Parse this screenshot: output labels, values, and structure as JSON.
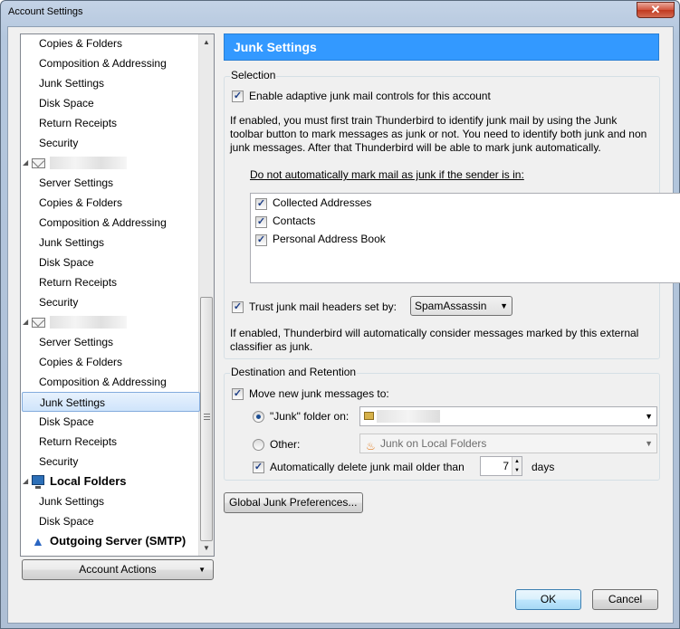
{
  "window": {
    "title": "Account Settings",
    "close_glyph": "✕"
  },
  "tree": {
    "items": [
      {
        "label": "Copies & Folders",
        "type": "item"
      },
      {
        "label": "Composition & Addressing",
        "type": "item"
      },
      {
        "label": "Junk Settings",
        "type": "item"
      },
      {
        "label": "Disk Space",
        "type": "item"
      },
      {
        "label": "Return Receipts",
        "type": "item"
      },
      {
        "label": "Security",
        "type": "item"
      },
      {
        "label": "",
        "type": "account",
        "icon": "envelope-icon"
      },
      {
        "label": "Server Settings",
        "type": "item"
      },
      {
        "label": "Copies & Folders",
        "type": "item"
      },
      {
        "label": "Composition & Addressing",
        "type": "item"
      },
      {
        "label": "Junk Settings",
        "type": "item"
      },
      {
        "label": "Disk Space",
        "type": "item"
      },
      {
        "label": "Return Receipts",
        "type": "item"
      },
      {
        "label": "Security",
        "type": "item"
      },
      {
        "label": "",
        "type": "account",
        "icon": "envelope-icon"
      },
      {
        "label": "Server Settings",
        "type": "item"
      },
      {
        "label": "Copies & Folders",
        "type": "item"
      },
      {
        "label": "Composition & Addressing",
        "type": "item"
      },
      {
        "label": "Junk Settings",
        "type": "item",
        "selected": true
      },
      {
        "label": "Disk Space",
        "type": "item"
      },
      {
        "label": "Return Receipts",
        "type": "item"
      },
      {
        "label": "Security",
        "type": "item"
      },
      {
        "label": "Local Folders",
        "type": "local",
        "icon": "computer-icon"
      },
      {
        "label": "Junk Settings",
        "type": "item"
      },
      {
        "label": "Disk Space",
        "type": "item"
      },
      {
        "label": "Outgoing Server (SMTP)",
        "type": "server",
        "icon": "server-icon"
      }
    ]
  },
  "account_actions_label": "Account Actions",
  "panel": {
    "header": "Junk Settings",
    "selection": {
      "title": "Selection",
      "enable_label": "Enable adaptive junk mail controls for this account",
      "enable_checked": true,
      "description": "If enabled, you must first train Thunderbird to identify junk mail by using the Junk toolbar button to mark messages as junk or not. You need to identify both junk and non junk messages. After that Thunderbird will be able to mark junk automatically.",
      "whitelist_label": "Do not automatically mark mail as junk if the sender is in:",
      "address_books": [
        {
          "label": "Collected Addresses",
          "checked": true
        },
        {
          "label": "Contacts",
          "checked": true
        },
        {
          "label": "Personal Address Book",
          "checked": true
        }
      ],
      "trust_label": "Trust junk mail headers set by:",
      "trust_checked": true,
      "trust_value": "SpamAssassin",
      "trust_description": "If enabled, Thunderbird will automatically consider messages marked by this external classifier as junk."
    },
    "destination": {
      "title": "Destination and Retention",
      "move_label": "Move new junk messages to:",
      "move_checked": true,
      "junk_folder_label": "\"Junk\" folder on:",
      "junk_folder_selected": true,
      "other_label": "Other:",
      "other_value": "Junk on Local Folders",
      "auto_delete_label": "Automatically delete junk mail older than",
      "auto_delete_checked": true,
      "days_value": "7",
      "days_label": "days"
    },
    "global_button": "Global Junk Preferences..."
  },
  "buttons": {
    "ok": "OK",
    "cancel": "Cancel"
  }
}
